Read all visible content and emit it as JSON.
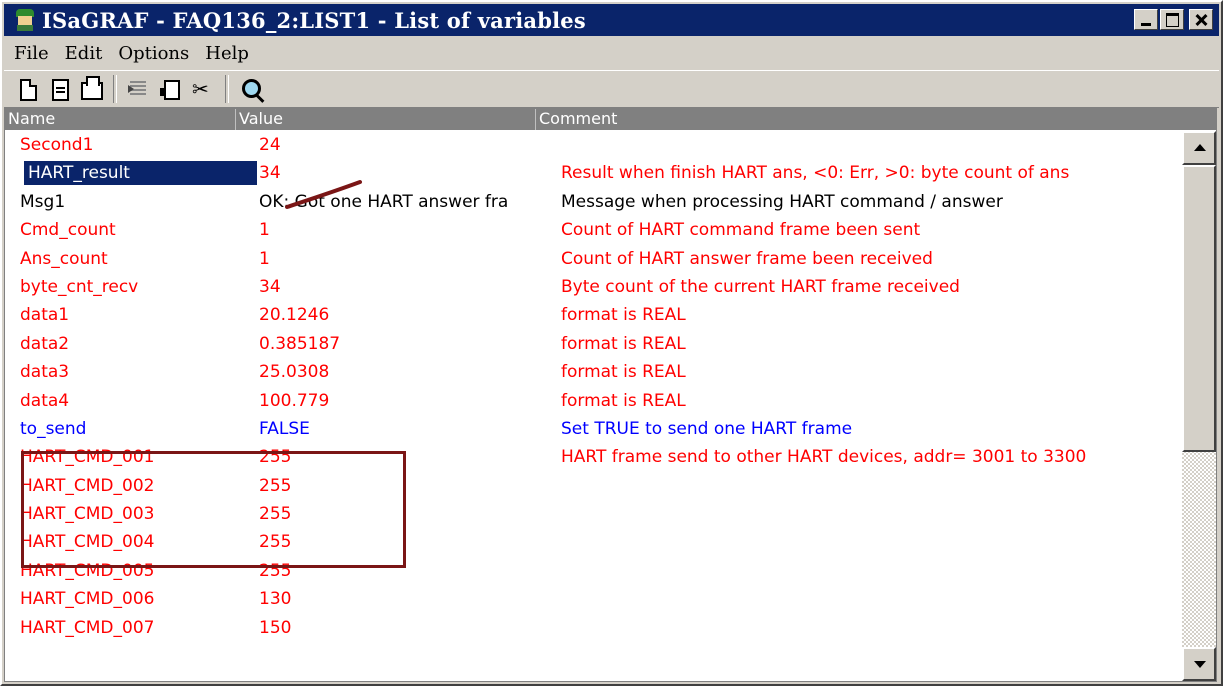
{
  "window": {
    "title": "ISaGRAF - FAQ136_2:LIST1 - List of variables"
  },
  "menu": [
    "File",
    "Edit",
    "Options",
    "Help"
  ],
  "toolbar": {
    "icons": [
      "new-icon",
      "properties-icon",
      "print-icon",
      "insert-icon",
      "paste-icon",
      "cut-icon",
      "search-icon"
    ]
  },
  "columns": {
    "name": "Name",
    "value": "Value",
    "comment": "Comment"
  },
  "colors": {
    "red": "#ff0000",
    "black": "#000000",
    "blue": "#0000ff",
    "selection": "#0a246a",
    "highlight_box": "#7a1616"
  },
  "rows": [
    {
      "name": "Second1",
      "value": "24",
      "comment": "",
      "color": "#ff0000"
    },
    {
      "name": "HART_result",
      "value": "34",
      "comment": "Result when finish HART ans, <0: Err, >0: byte count of ans",
      "color": "#ff0000",
      "selected": true
    },
    {
      "name": "Msg1",
      "value": "OK: Got one HART answer fra",
      "comment": "Message when processing HART command / answer",
      "color": "#000000"
    },
    {
      "name": "Cmd_count",
      "value": "1",
      "comment": "Count of HART command frame been sent",
      "color": "#ff0000"
    },
    {
      "name": "Ans_count",
      "value": "1",
      "comment": "Count of HART answer frame been received",
      "color": "#ff0000"
    },
    {
      "name": "byte_cnt_recv",
      "value": "34",
      "comment": "Byte count of the current HART frame received",
      "color": "#ff0000"
    },
    {
      "name": "data1",
      "value": "20.1246",
      "comment": "format is REAL",
      "color": "#ff0000"
    },
    {
      "name": "data2",
      "value": "0.385187",
      "comment": "format is REAL",
      "color": "#ff0000"
    },
    {
      "name": "data3",
      "value": "25.0308",
      "comment": "format is REAL",
      "color": "#ff0000"
    },
    {
      "name": "data4",
      "value": "100.779",
      "comment": "format is REAL",
      "color": "#ff0000"
    },
    {
      "name": "to_send",
      "value": "FALSE",
      "comment": "Set TRUE to send one HART frame",
      "color": "#0000ff"
    },
    {
      "name": "HART_CMD_001",
      "value": "255",
      "comment": "HART frame send to other HART devices, addr= 3001 to 3300",
      "color": "#ff0000"
    },
    {
      "name": "HART_CMD_002",
      "value": "255",
      "comment": "",
      "color": "#ff0000"
    },
    {
      "name": "HART_CMD_003",
      "value": "255",
      "comment": "",
      "color": "#ff0000"
    },
    {
      "name": "HART_CMD_004",
      "value": "255",
      "comment": "",
      "color": "#ff0000"
    },
    {
      "name": "HART_CMD_005",
      "value": "255",
      "comment": "",
      "color": "#ff0000"
    },
    {
      "name": "HART_CMD_006",
      "value": "130",
      "comment": "",
      "color": "#ff0000"
    },
    {
      "name": "HART_CMD_007",
      "value": "150",
      "comment": "",
      "color": "#ff0000"
    }
  ]
}
